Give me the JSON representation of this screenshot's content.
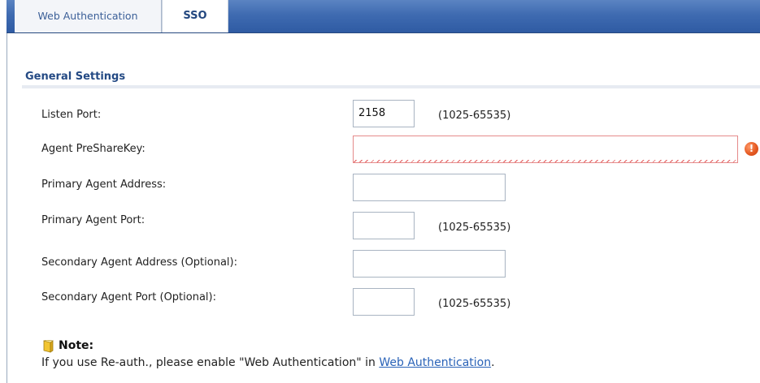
{
  "tabs": [
    {
      "label": "Web Authentication",
      "active": false
    },
    {
      "label": "SSO",
      "active": true
    }
  ],
  "section": {
    "title": "General Settings"
  },
  "fields": {
    "listen_port": {
      "label": "Listen Port:",
      "value": "2158",
      "hint": "(1025-65535)"
    },
    "agent_presharekey": {
      "label": "Agent PreShareKey:",
      "value": "",
      "state": "error"
    },
    "primary_agent_address": {
      "label": "Primary Agent Address:",
      "value": ""
    },
    "primary_agent_port": {
      "label": "Primary Agent Port:",
      "value": "",
      "hint": "(1025-65535)"
    },
    "secondary_agent_address": {
      "label": "Secondary Agent Address (Optional):",
      "value": ""
    },
    "secondary_agent_port": {
      "label": "Secondary Agent Port (Optional):",
      "value": "",
      "hint": "(1025-65535)"
    }
  },
  "note": {
    "title": "Note:",
    "text_before": "If you use Re-auth., please enable \"Web Authentication\" in ",
    "link": "Web Authentication",
    "text_after": "."
  },
  "colors": {
    "header_blue": "#3f6bb1",
    "section_title": "#244a84",
    "error_red": "#e35a5a",
    "link_blue": "#2a63b8"
  },
  "icons": {
    "error": "error-icon",
    "note": "note-icon"
  }
}
